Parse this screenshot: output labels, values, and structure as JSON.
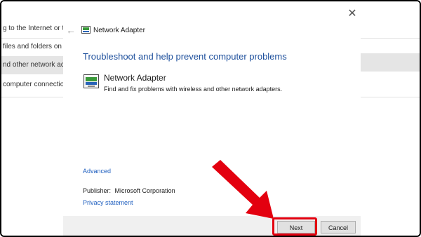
{
  "background_window": {
    "rows": [
      "g to the Internet or to",
      "files and folders on c",
      "nd other network ada",
      "computer connection"
    ]
  },
  "dialog": {
    "title": "Network Adapter",
    "heading": "Troubleshoot and help prevent computer problems",
    "item": {
      "title": "Network Adapter",
      "description": "Find and fix problems with wireless and other network adapters."
    },
    "advanced_label": "Advanced",
    "publisher_label": "Publisher:",
    "publisher_value": "Microsoft Corporation",
    "privacy_label": "Privacy statement",
    "next_label": "Next",
    "cancel_label": "Cancel",
    "close_symbol": "✕",
    "back_symbol": "←"
  },
  "colors": {
    "heading": "#1d4f9c",
    "link": "#1f5fbf",
    "annotation": "#e3000f"
  },
  "icons": [
    "back-arrow-icon",
    "network-adapter-icon",
    "close-icon",
    "pointer-arrow-icon"
  ]
}
